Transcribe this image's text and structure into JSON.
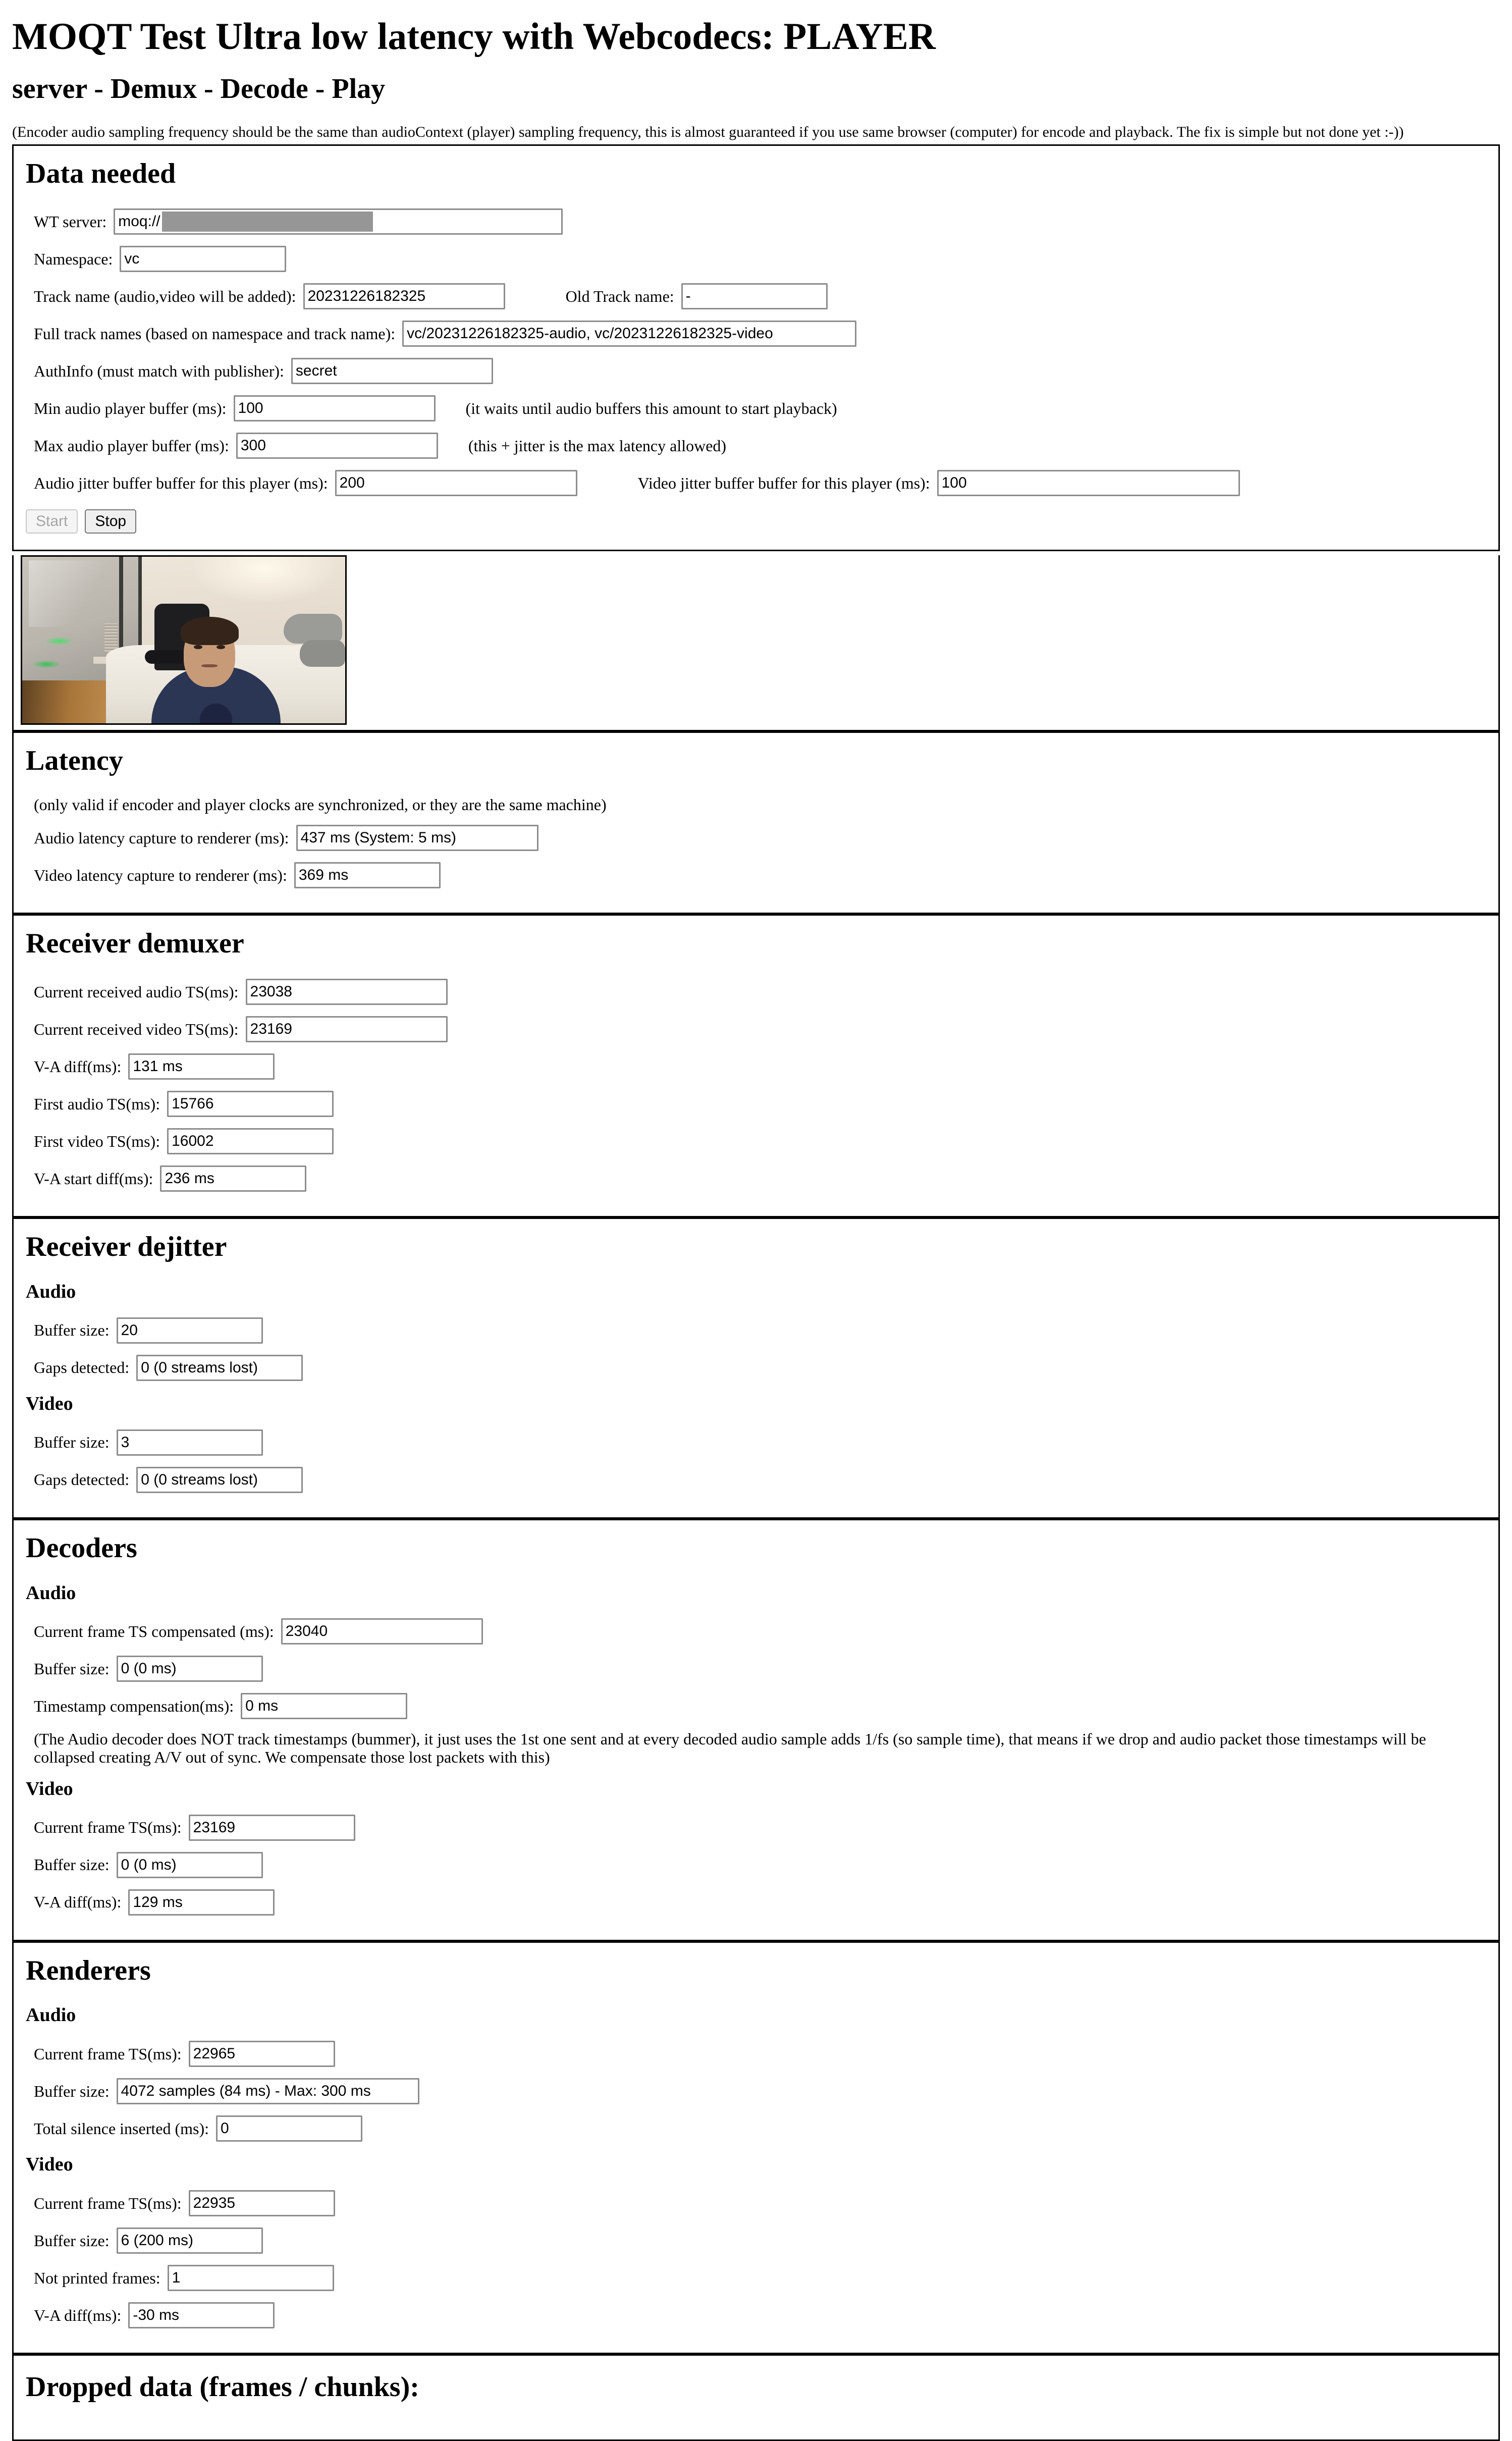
{
  "page": {
    "title": "MOQT Test Ultra low latency with Webcodecs: PLAYER",
    "subtitle": "server - Demux - Decode - Play",
    "note": "(Encoder audio sampling frequency should be the same than audioContext (player) sampling frequency, this is almost guaranteed if you use same browser (computer) for encode and playback. The fix is simple but not done yet :-))"
  },
  "data_needed": {
    "heading": "Data needed",
    "wt_server_label": "WT server:",
    "wt_server_value": "moq://                                    33/moq",
    "namespace_label": "Namespace:",
    "namespace_value": "vc",
    "track_name_label": "Track name (audio,video will be added):",
    "track_name_value": "20231226182325",
    "old_track_name_label": "Old Track name:",
    "old_track_name_value": "-",
    "full_track_names_label": "Full track names (based on namespace and track name):",
    "full_track_names_value": "vc/20231226182325-audio, vc/20231226182325-video",
    "authinfo_label": "AuthInfo (must match with publisher):",
    "authinfo_value": "secret",
    "min_audio_buffer_label": "Min audio player buffer (ms):",
    "min_audio_buffer_value": "100",
    "min_audio_buffer_hint": "(it waits until audio buffers this amount to start playback)",
    "max_audio_buffer_label": "Max audio player buffer (ms):",
    "max_audio_buffer_value": "300",
    "max_audio_buffer_hint": "(this + jitter is the max latency allowed)",
    "audio_jitter_label": "Audio jitter buffer buffer for this player (ms):",
    "audio_jitter_value": "200",
    "video_jitter_label": "Video jitter buffer buffer for this player (ms):",
    "video_jitter_value": "100",
    "start_button": "Start",
    "stop_button": "Stop"
  },
  "latency": {
    "heading": "Latency",
    "note": "(only valid if encoder and player clocks are synchronized, or they are the same machine)",
    "audio_label": "Audio latency capture to renderer (ms):",
    "audio_value": "437 ms (System: 5 ms)",
    "video_label": "Video latency capture to renderer (ms):",
    "video_value": "369 ms"
  },
  "receiver_demuxer": {
    "heading": "Receiver demuxer",
    "cur_audio_ts_label": "Current received audio TS(ms):",
    "cur_audio_ts_value": "23038",
    "cur_video_ts_label": "Current received video TS(ms):",
    "cur_video_ts_value": "23169",
    "va_diff_label": "V-A diff(ms):",
    "va_diff_value": "131 ms",
    "first_audio_ts_label": "First audio TS(ms):",
    "first_audio_ts_value": "15766",
    "first_video_ts_label": "First video TS(ms):",
    "first_video_ts_value": "16002",
    "va_start_diff_label": "V-A start diff(ms):",
    "va_start_diff_value": "236 ms"
  },
  "receiver_dejitter": {
    "heading": "Receiver dejitter",
    "audio_heading": "Audio",
    "audio_buffer_size_label": "Buffer size:",
    "audio_buffer_size_value": "20",
    "audio_gaps_label": "Gaps detected:",
    "audio_gaps_value": "0 (0 streams lost)",
    "video_heading": "Video",
    "video_buffer_size_label": "Buffer size:",
    "video_buffer_size_value": "3",
    "video_gaps_label": "Gaps detected:",
    "video_gaps_value": "0 (0 streams lost)"
  },
  "decoders": {
    "heading": "Decoders",
    "audio_heading": "Audio",
    "audio_cur_ts_label": "Current frame TS compensated (ms):",
    "audio_cur_ts_value": "23040",
    "audio_buffer_size_label": "Buffer size:",
    "audio_buffer_size_value": "0 (0 ms)",
    "audio_ts_comp_label": "Timestamp compensation(ms):",
    "audio_ts_comp_value": "0 ms",
    "note": "(The Audio decoder does NOT track timestamps (bummer), it just uses the 1st one sent and at every decoded audio sample adds 1/fs (so sample time), that means if we drop and audio packet those timestamps will be collapsed creating A/V out of sync. We compensate those lost packets with this)",
    "video_heading": "Video",
    "video_cur_ts_label": "Current frame TS(ms):",
    "video_cur_ts_value": "23169",
    "video_buffer_size_label": "Buffer size:",
    "video_buffer_size_value": "0 (0 ms)",
    "video_va_diff_label": "V-A diff(ms):",
    "video_va_diff_value": "129 ms"
  },
  "renderers": {
    "heading": "Renderers",
    "audio_heading": "Audio",
    "audio_cur_ts_label": "Current frame TS(ms):",
    "audio_cur_ts_value": "22965",
    "audio_buffer_size_label": "Buffer size:",
    "audio_buffer_size_value": "4072 samples (84 ms) - Max: 300 ms",
    "audio_silence_label": "Total silence inserted (ms):",
    "audio_silence_value": "0",
    "video_heading": "Video",
    "video_cur_ts_label": "Current frame TS(ms):",
    "video_cur_ts_value": "22935",
    "video_buffer_size_label": "Buffer size:",
    "video_buffer_size_value": "6 (200 ms)",
    "video_not_printed_label": "Not printed frames:",
    "video_not_printed_value": "1",
    "video_va_diff_label": "V-A diff(ms):",
    "video_va_diff_value": "-30 ms"
  },
  "dropped": {
    "heading": "Dropped data (frames / chunks):"
  }
}
